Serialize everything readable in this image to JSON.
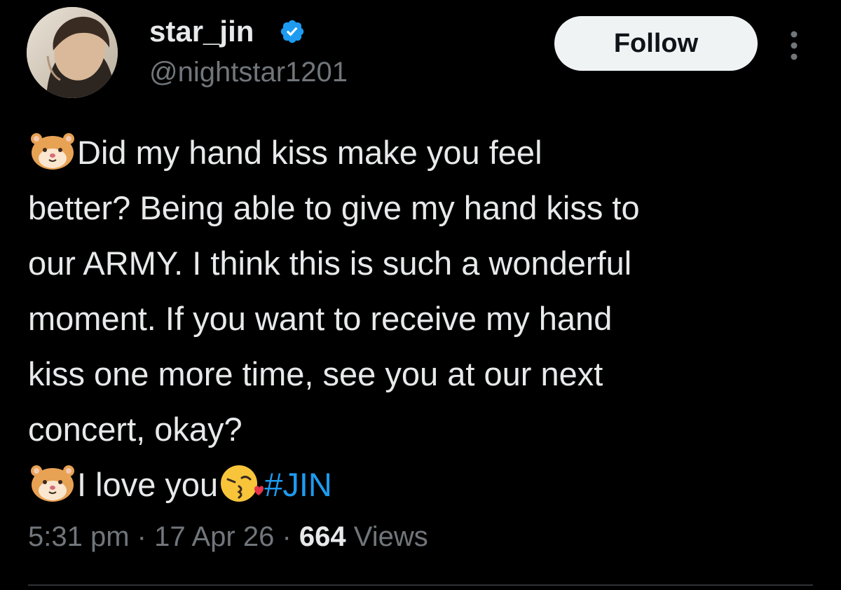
{
  "author": {
    "display_name": "star_jin",
    "handle": "@nightstar1201",
    "verified": true,
    "verified_icon": "verified-badge-icon",
    "avatar": "profile-photo"
  },
  "actions": {
    "follow_label": "Follow",
    "more_icon": "more-options-icon"
  },
  "tweet": {
    "lines": [
      "Did my hand kiss make you feel",
      "better? Being able to give my hand kiss to",
      "our ARMY. I think this is such a wonderful",
      "moment. If you want to receive my hand",
      "kiss one more time, see you at our next",
      "concert, okay?"
    ],
    "closing_text": "I love you",
    "hashtag": "#JIN",
    "emoji_1": "hamster-emoji",
    "emoji_2": "kissing-face-emoji"
  },
  "meta": {
    "time": "5:31 pm",
    "sep1": " · ",
    "date": "17 Apr 26",
    "sep2": " · ",
    "views_count": "664",
    "views_label": " Views"
  },
  "colors": {
    "background": "#000000",
    "text": "#e7e9ea",
    "muted": "#71767b",
    "accent": "#1d9bf0",
    "follow_bg": "#eff3f4"
  }
}
